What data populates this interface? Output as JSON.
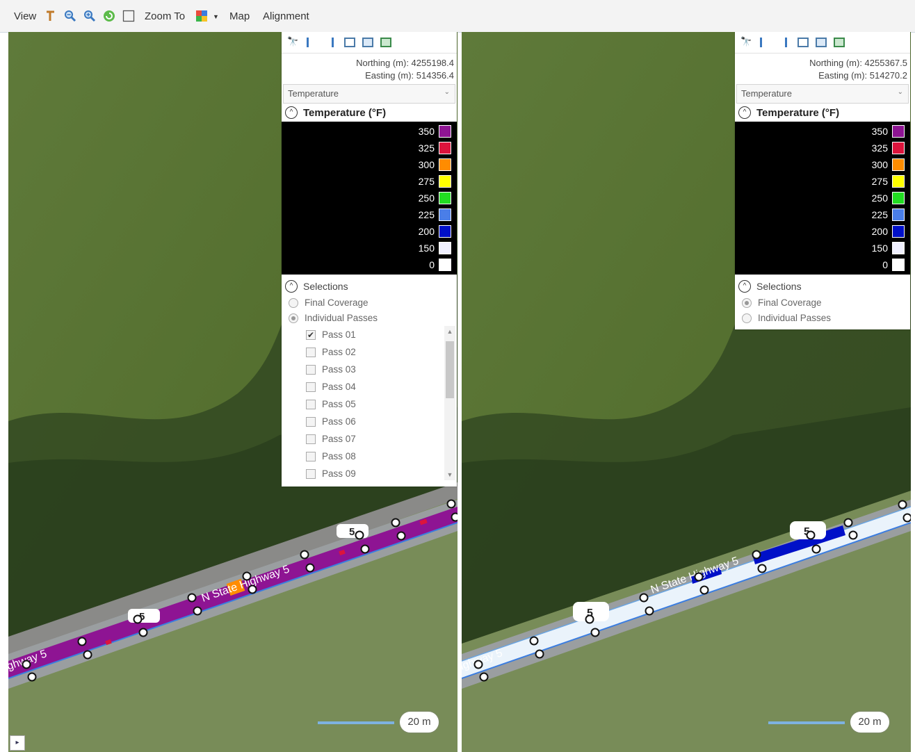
{
  "toolbar": {
    "view_label": "View",
    "zoom_to_label": "Zoom To",
    "map_label": "Map",
    "alignment_label": "Alignment",
    "icons": [
      "pan-icon",
      "zoom-out-icon",
      "zoom-in-icon",
      "refresh-icon",
      "select-rect-icon",
      "layers-icon",
      "dropdown-arrow-icon"
    ]
  },
  "left_panel": {
    "northing": "Northing (m): 4255198.4",
    "easting": "Easting (m): 514356.4",
    "dropdown_value": "Temperature",
    "legend_title": "Temperature (°F)",
    "legend": [
      {
        "value": "350",
        "color": "#8e1493"
      },
      {
        "value": "325",
        "color": "#dc143c"
      },
      {
        "value": "300",
        "color": "#ff8c00"
      },
      {
        "value": "275",
        "color": "#ffff00"
      },
      {
        "value": "250",
        "color": "#22dd22"
      },
      {
        "value": "225",
        "color": "#4a7ee8"
      },
      {
        "value": "200",
        "color": "#0010c8"
      },
      {
        "value": "150",
        "color": "#f0f0ff"
      },
      {
        "value": "0",
        "color": "#ffffff"
      }
    ],
    "selections_label": "Selections",
    "final_coverage_label": "Final Coverage",
    "individual_passes_label": "Individual Passes",
    "selected_mode": "individual",
    "passes": [
      {
        "label": "Pass 01",
        "checked": true
      },
      {
        "label": "Pass 02",
        "checked": false
      },
      {
        "label": "Pass 03",
        "checked": false
      },
      {
        "label": "Pass 04",
        "checked": false
      },
      {
        "label": "Pass 05",
        "checked": false
      },
      {
        "label": "Pass 06",
        "checked": false
      },
      {
        "label": "Pass 07",
        "checked": false
      },
      {
        "label": "Pass 08",
        "checked": false
      },
      {
        "label": "Pass 09",
        "checked": false
      }
    ]
  },
  "right_panel": {
    "northing": "Northing (m): 4255367.5",
    "easting": "Easting (m): 514270.2",
    "dropdown_value": "Temperature",
    "legend_title": "Temperature (°F)",
    "selections_label": "Selections",
    "final_coverage_label": "Final Coverage",
    "individual_passes_label": "Individual Passes",
    "selected_mode": "final"
  },
  "map": {
    "road_label_left_main": "N State Highway 5",
    "road_label_left_edge": "ghway 5",
    "road_label_right_main": "N State Highway 5",
    "road_label_right_edge": "ighway 5",
    "shield_number": "5",
    "scale_label": "20 m",
    "left_pass_color": "#8e1493",
    "right_pass_color": "#0010c8"
  }
}
